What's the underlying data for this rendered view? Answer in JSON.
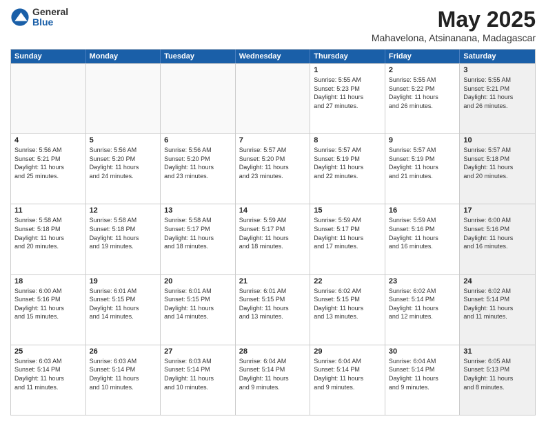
{
  "logo": {
    "general": "General",
    "blue": "Blue"
  },
  "title": "May 2025",
  "location": "Mahavelona, Atsinanana, Madagascar",
  "days": [
    "Sunday",
    "Monday",
    "Tuesday",
    "Wednesday",
    "Thursday",
    "Friday",
    "Saturday"
  ],
  "weeks": [
    [
      {
        "num": "",
        "empty": true
      },
      {
        "num": "",
        "empty": true
      },
      {
        "num": "",
        "empty": true
      },
      {
        "num": "",
        "empty": true
      },
      {
        "num": "1",
        "rise": "5:55 AM",
        "set": "5:23 PM",
        "daylight": "11 hours and 27 minutes."
      },
      {
        "num": "2",
        "rise": "5:55 AM",
        "set": "5:22 PM",
        "daylight": "11 hours and 26 minutes."
      },
      {
        "num": "3",
        "rise": "5:55 AM",
        "set": "5:21 PM",
        "daylight": "11 hours and 26 minutes.",
        "shaded": true
      }
    ],
    [
      {
        "num": "4",
        "rise": "5:56 AM",
        "set": "5:21 PM",
        "daylight": "11 hours and 25 minutes."
      },
      {
        "num": "5",
        "rise": "5:56 AM",
        "set": "5:20 PM",
        "daylight": "11 hours and 24 minutes."
      },
      {
        "num": "6",
        "rise": "5:56 AM",
        "set": "5:20 PM",
        "daylight": "11 hours and 23 minutes."
      },
      {
        "num": "7",
        "rise": "5:57 AM",
        "set": "5:20 PM",
        "daylight": "11 hours and 23 minutes."
      },
      {
        "num": "8",
        "rise": "5:57 AM",
        "set": "5:19 PM",
        "daylight": "11 hours and 22 minutes."
      },
      {
        "num": "9",
        "rise": "5:57 AM",
        "set": "5:19 PM",
        "daylight": "11 hours and 21 minutes."
      },
      {
        "num": "10",
        "rise": "5:57 AM",
        "set": "5:18 PM",
        "daylight": "11 hours and 20 minutes.",
        "shaded": true
      }
    ],
    [
      {
        "num": "11",
        "rise": "5:58 AM",
        "set": "5:18 PM",
        "daylight": "11 hours and 20 minutes."
      },
      {
        "num": "12",
        "rise": "5:58 AM",
        "set": "5:18 PM",
        "daylight": "11 hours and 19 minutes."
      },
      {
        "num": "13",
        "rise": "5:58 AM",
        "set": "5:17 PM",
        "daylight": "11 hours and 18 minutes."
      },
      {
        "num": "14",
        "rise": "5:59 AM",
        "set": "5:17 PM",
        "daylight": "11 hours and 18 minutes."
      },
      {
        "num": "15",
        "rise": "5:59 AM",
        "set": "5:17 PM",
        "daylight": "11 hours and 17 minutes."
      },
      {
        "num": "16",
        "rise": "5:59 AM",
        "set": "5:16 PM",
        "daylight": "11 hours and 16 minutes."
      },
      {
        "num": "17",
        "rise": "6:00 AM",
        "set": "5:16 PM",
        "daylight": "11 hours and 16 minutes.",
        "shaded": true
      }
    ],
    [
      {
        "num": "18",
        "rise": "6:00 AM",
        "set": "5:16 PM",
        "daylight": "11 hours and 15 minutes."
      },
      {
        "num": "19",
        "rise": "6:01 AM",
        "set": "5:15 PM",
        "daylight": "11 hours and 14 minutes."
      },
      {
        "num": "20",
        "rise": "6:01 AM",
        "set": "5:15 PM",
        "daylight": "11 hours and 14 minutes."
      },
      {
        "num": "21",
        "rise": "6:01 AM",
        "set": "5:15 PM",
        "daylight": "11 hours and 13 minutes."
      },
      {
        "num": "22",
        "rise": "6:02 AM",
        "set": "5:15 PM",
        "daylight": "11 hours and 13 minutes."
      },
      {
        "num": "23",
        "rise": "6:02 AM",
        "set": "5:14 PM",
        "daylight": "11 hours and 12 minutes."
      },
      {
        "num": "24",
        "rise": "6:02 AM",
        "set": "5:14 PM",
        "daylight": "11 hours and 11 minutes.",
        "shaded": true
      }
    ],
    [
      {
        "num": "25",
        "rise": "6:03 AM",
        "set": "5:14 PM",
        "daylight": "11 hours and 11 minutes."
      },
      {
        "num": "26",
        "rise": "6:03 AM",
        "set": "5:14 PM",
        "daylight": "11 hours and 10 minutes."
      },
      {
        "num": "27",
        "rise": "6:03 AM",
        "set": "5:14 PM",
        "daylight": "11 hours and 10 minutes."
      },
      {
        "num": "28",
        "rise": "6:04 AM",
        "set": "5:14 PM",
        "daylight": "11 hours and 9 minutes."
      },
      {
        "num": "29",
        "rise": "6:04 AM",
        "set": "5:14 PM",
        "daylight": "11 hours and 9 minutes."
      },
      {
        "num": "30",
        "rise": "6:04 AM",
        "set": "5:14 PM",
        "daylight": "11 hours and 9 minutes."
      },
      {
        "num": "31",
        "rise": "6:05 AM",
        "set": "5:13 PM",
        "daylight": "11 hours and 8 minutes.",
        "shaded": true
      }
    ]
  ]
}
